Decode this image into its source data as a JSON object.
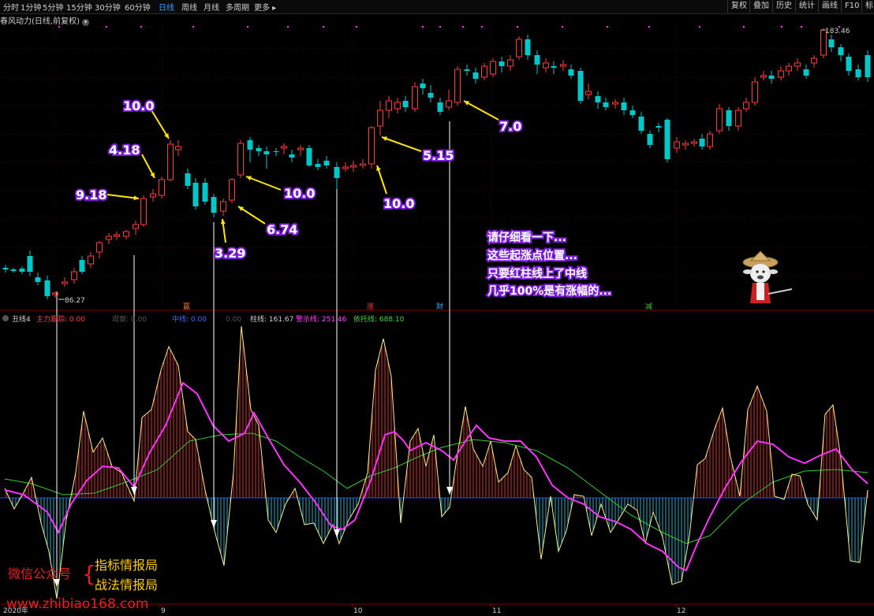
{
  "periods": [
    {
      "label": "分时"
    },
    {
      "label": "1分钟"
    },
    {
      "label": "5分钟"
    },
    {
      "label": "15分钟"
    },
    {
      "label": "30分钟"
    },
    {
      "label": "60分钟"
    },
    {
      "label": "日线",
      "active": true
    },
    {
      "label": "周线"
    },
    {
      "label": "月线"
    },
    {
      "label": "多周期"
    },
    {
      "label": "更多 ▸"
    }
  ],
  "right_tools": [
    "复权",
    "叠加",
    "历史",
    "统计",
    "画线",
    "F10",
    "标"
  ],
  "stock_title": "春风动力(日线,前复权)",
  "price": {
    "high_label": "183.46",
    "low_label": "86.27"
  },
  "annotations": [
    "10.0",
    "4.18",
    "9.18",
    "3.29",
    "6.74",
    "10.0",
    "10.0",
    "5.15",
    "7.0"
  ],
  "note_lines": [
    "请仔细看一下...",
    "这些起涨点位置...",
    "只要红柱线上了中线",
    "几乎100%是有涨幅的..."
  ],
  "markers": [
    "赢",
    "涨",
    "财",
    "减"
  ],
  "indicator": {
    "name": "丑线4",
    "items": [
      {
        "label": "主力跟踪: 0.00",
        "color": "#ff4040"
      },
      {
        "label": "观察: 0.00",
        "color": "#555555"
      },
      {
        "label": "中线: 0.00",
        "color": "#3a6bff"
      },
      {
        "label": "0.00",
        "color": "#555555"
      },
      {
        "label": "柱线: 161.67",
        "color": "#d0d0d0"
      },
      {
        "label": "警示线: 251.46",
        "color": "#ff44ff"
      },
      {
        "label": "依托线: 688.10",
        "color": "#44d444"
      }
    ]
  },
  "x_axis": [
    "2020年",
    "9",
    "10",
    "11",
    "12"
  ],
  "watermark": {
    "wechat": "微信公众号",
    "brand1": "指标情报局",
    "brand2": "战法情报局",
    "url": "www.zhibiao168.com"
  },
  "colors": {
    "up": "#ff3b3b",
    "down": "#00c8c8",
    "pink": "#ff33ff",
    "green": "#33cc33",
    "yellow": "#ffe600",
    "purple": "#7a1fd6"
  }
}
